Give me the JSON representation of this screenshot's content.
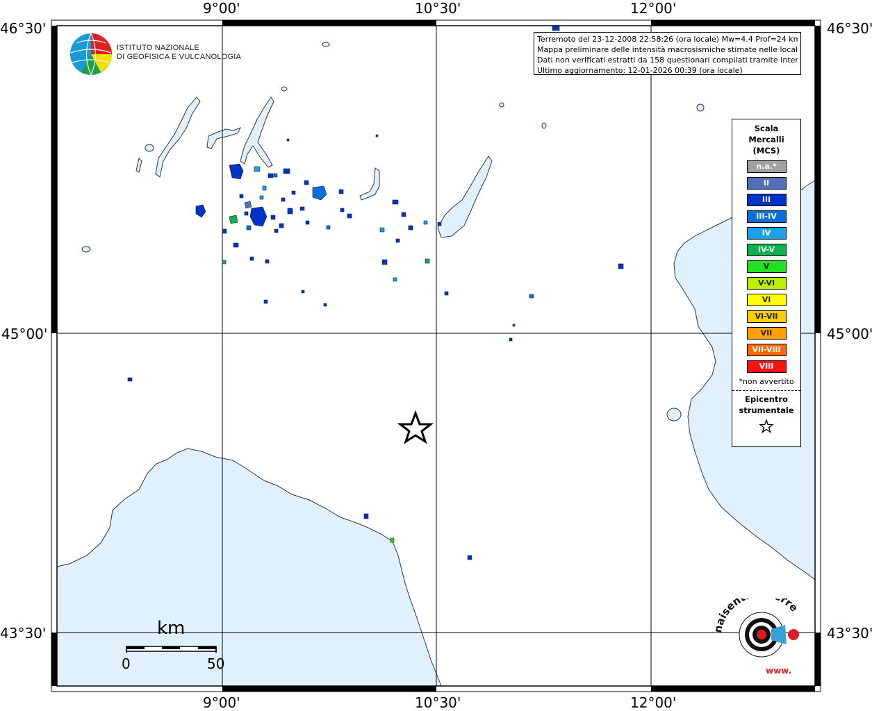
{
  "map": {
    "longitude_labels": [
      "9°00'",
      "10°30'",
      "12°00'"
    ],
    "latitude_labels": [
      "46°30'",
      "45°00'",
      "43°30'"
    ],
    "sea_color": "#e0f0fc",
    "land_color": "#ffffff",
    "epicenter_symbol": "star-icon"
  },
  "event_info": {
    "line1": "Terremoto del 23-12-2008 22:58:26 (ora locale) Mw=4.4 Prof=24 km",
    "line2": "Mappa preliminare delle intensità macrosismiche stimate nelle località",
    "line3": "Dati non verificati estratti da 158 questionari compilati tramite Internet.",
    "line4": "Ultimo aggiornamento: 12-01-2026 00:39 (ora locale)"
  },
  "ingv_logo": {
    "line1": "ISTITUTO NAZIONALE",
    "line2": "DI GEOFISICA E VULCANOLOGIA"
  },
  "legend": {
    "title_line1": "Scala",
    "title_line2": "Mercalli",
    "title_line3": "(MCS)",
    "items": [
      {
        "label": "n.a.*",
        "color": "#a0a0a0"
      },
      {
        "label": "II",
        "color": "#4f6fb8"
      },
      {
        "label": "III",
        "color": "#0033c8"
      },
      {
        "label": "III-IV",
        "color": "#0a6fd8"
      },
      {
        "label": "IV",
        "color": "#1ea0e8"
      },
      {
        "label": "IV-V",
        "color": "#10b050"
      },
      {
        "label": "V",
        "color": "#22e022"
      },
      {
        "label": "V-VI",
        "color": "#b8f000"
      },
      {
        "label": "VI",
        "color": "#ffff00"
      },
      {
        "label": "VI-VII",
        "color": "#f8d000"
      },
      {
        "label": "VII",
        "color": "#ffa000"
      },
      {
        "label": "VII-VIII",
        "color": "#ff6a00"
      },
      {
        "label": "VIII",
        "color": "#ff1010"
      }
    ],
    "note": "*non avvertito",
    "epicenter_line1": "Epicentro",
    "epicenter_line2": "strumentale"
  },
  "scale_bar": {
    "unit": "km",
    "min_label": "0",
    "max_label": "50"
  },
  "watermark_logo": {
    "text": "haisentitoilterremoto.it",
    "url_text": "www."
  }
}
